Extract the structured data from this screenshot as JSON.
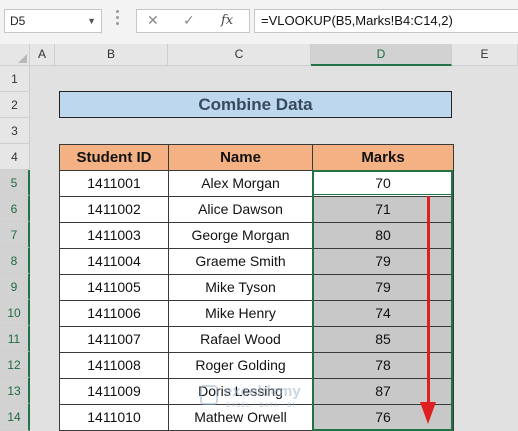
{
  "formula_bar": {
    "name_box": "D5",
    "cancel_icon": "✕",
    "enter_icon": "✓",
    "fx_label": "fx",
    "formula": "=VLOOKUP(B5,Marks!B4:C14,2)"
  },
  "columns": [
    "A",
    "B",
    "C",
    "D",
    "E"
  ],
  "rows": [
    "1",
    "2",
    "3",
    "4",
    "5",
    "6",
    "7",
    "8",
    "9",
    "10",
    "11",
    "12",
    "13",
    "14"
  ],
  "selected_column": "D",
  "title": "Combine Data",
  "table": {
    "headers": [
      "Student ID",
      "Name",
      "Marks"
    ],
    "rows": [
      {
        "id": "1411001",
        "name": "Alex Morgan",
        "marks": "70"
      },
      {
        "id": "1411002",
        "name": "Alice Dawson",
        "marks": "71"
      },
      {
        "id": "1411003",
        "name": "George Morgan",
        "marks": "80"
      },
      {
        "id": "1411004",
        "name": "Graeme Smith",
        "marks": "79"
      },
      {
        "id": "1411005",
        "name": "Mike Tyson",
        "marks": "79"
      },
      {
        "id": "1411006",
        "name": "Mike Henry",
        "marks": "74"
      },
      {
        "id": "1411007",
        "name": "Rafael Wood",
        "marks": "85"
      },
      {
        "id": "1411008",
        "name": "Roger Golding",
        "marks": "78"
      },
      {
        "id": "1411009",
        "name": "Doris Lessing",
        "marks": "87"
      },
      {
        "id": "1411010",
        "name": "Mathew Orwell",
        "marks": "76"
      }
    ]
  },
  "watermark": {
    "line1": "exceldemy",
    "line2": "EXCEL · DATA · BI"
  },
  "colors": {
    "accent": "#217346",
    "header_fill": "#f4b183",
    "title_fill": "#bdd7ee",
    "arrow": "#e02020"
  }
}
